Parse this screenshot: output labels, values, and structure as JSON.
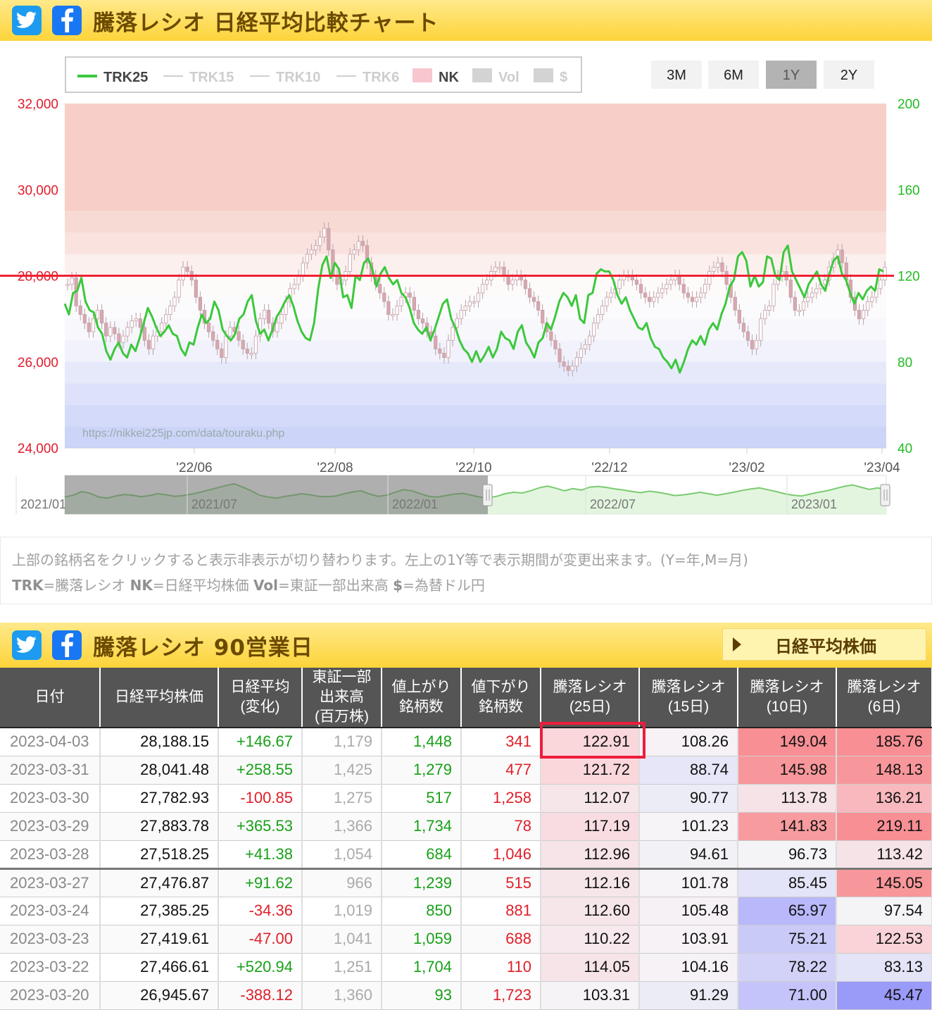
{
  "top_header": {
    "title": "騰落レシオ 日経平均比較チャート",
    "twitter_icon": "twitter-icon",
    "facebook_icon": "facebook-icon"
  },
  "legend": [
    {
      "label": "TRK25",
      "active": true,
      "color": "#3cc83c"
    },
    {
      "label": "TRK15",
      "active": false
    },
    {
      "label": "TRK10",
      "active": false
    },
    {
      "label": "TRK6",
      "active": false
    },
    {
      "label": "NK",
      "active": true,
      "color": "#f7c6cf"
    },
    {
      "label": "Vol",
      "active": false
    },
    {
      "label": "$",
      "active": false
    }
  ],
  "range_buttons": [
    {
      "label": "3M",
      "selected": false
    },
    {
      "label": "6M",
      "selected": false
    },
    {
      "label": "1Y",
      "selected": true
    },
    {
      "label": "2Y",
      "selected": false
    }
  ],
  "chart_data": {
    "type": "line",
    "left_axis_ticks": [
      "32,000",
      "30,000",
      "28,000",
      "26,000",
      "24,000"
    ],
    "right_axis_ticks": [
      "200",
      "160",
      "120",
      "80",
      "40"
    ],
    "x_ticks": [
      "'22/06",
      "'22/08",
      "'22/10",
      "'22/12",
      "'23/02",
      "'23/04"
    ],
    "left_ylim": [
      24000,
      32000
    ],
    "right_ylim": [
      40,
      200
    ],
    "reference_line": {
      "axis": "right",
      "value": 120,
      "color": "#ee2233"
    },
    "series": [
      {
        "name": "TRK25",
        "axis": "right",
        "color": "#3cc83c",
        "values": [
          107,
          102,
          112,
          113,
          119,
          108,
          104,
          103,
          96,
          93,
          85,
          81,
          86,
          89,
          84,
          82,
          88,
          85,
          91,
          98,
          105,
          101,
          96,
          92,
          94,
          97,
          93,
          92,
          86,
          83,
          89,
          88,
          96,
          102,
          98,
          100,
          108,
          104,
          95,
          92,
          90,
          93,
          100,
          102,
          108,
          111,
          99,
          93,
          95,
          90,
          95,
          101,
          104,
          108,
          111,
          106,
          99,
          94,
          91,
          90,
          98,
          114,
          125,
          129,
          119,
          126,
          123,
          110,
          111,
          105,
          120,
          118,
          126,
          128,
          123,
          115,
          121,
          124,
          119,
          116,
          118,
          112,
          110,
          105,
          98,
          95,
          93,
          96,
          90,
          95,
          101,
          107,
          109,
          100,
          96,
          90,
          86,
          84,
          80,
          85,
          80,
          83,
          87,
          82,
          86,
          94,
          91,
          90,
          86,
          94,
          97,
          89,
          86,
          82,
          89,
          91,
          98,
          95,
          101,
          108,
          112,
          110,
          106,
          111,
          100,
          98,
          111,
          112,
          121,
          123,
          122,
          122,
          118,
          111,
          107,
          110,
          104,
          100,
          96,
          95,
          98,
          91,
          87,
          86,
          82,
          80,
          77,
          81,
          75,
          80,
          86,
          90,
          88,
          92,
          88,
          95,
          98,
          95,
          102,
          107,
          115,
          118,
          129,
          131,
          127,
          115,
          120,
          115,
          117,
          129,
          128,
          120,
          118,
          131,
          134,
          122,
          118,
          114,
          110,
          116,
          119,
          122,
          116,
          113,
          121,
          127,
          129,
          121,
          118,
          112,
          107,
          112,
          109,
          113,
          115,
          113,
          123,
          122
        ]
      },
      {
        "name": "NK",
        "axis": "left",
        "type": "candlestick",
        "color": "#d7a8b0",
        "values": [
          27800,
          27950,
          27300,
          27100,
          26900,
          26700,
          27000,
          27200,
          26900,
          26600,
          26800,
          26650,
          26450,
          26600,
          26800,
          26950,
          27000,
          26800,
          26500,
          26300,
          26600,
          26700,
          26900,
          27100,
          27300,
          27500,
          27900,
          28200,
          28100,
          27900,
          27500,
          27200,
          26900,
          26700,
          26500,
          26300,
          26100,
          26600,
          26800,
          26700,
          26500,
          26300,
          26200,
          26200,
          26600,
          27000,
          27200,
          26900,
          26700,
          26900,
          27100,
          27400,
          27700,
          27800,
          28000,
          28300,
          28500,
          28600,
          28700,
          28900,
          29100,
          28600,
          28000,
          27800,
          27900,
          28100,
          28500,
          28600,
          28800,
          28700,
          28300,
          28000,
          27800,
          27600,
          27400,
          27100,
          27100,
          27300,
          27500,
          27600,
          27500,
          27200,
          27000,
          26900,
          26700,
          26600,
          26300,
          26200,
          26100,
          26500,
          26800,
          27000,
          27200,
          27300,
          27400,
          27400,
          27600,
          27800,
          27900,
          28100,
          28200,
          28200,
          28000,
          27800,
          27900,
          28000,
          27900,
          27700,
          27500,
          27400,
          27200,
          26900,
          26700,
          26500,
          26300,
          26000,
          25900,
          25800,
          25900,
          26100,
          26300,
          26400,
          26600,
          26900,
          27100,
          27300,
          27500,
          27600,
          27700,
          27900,
          28000,
          28000,
          27900,
          27800,
          27600,
          27500,
          27400,
          27500,
          27600,
          27700,
          27800,
          27900,
          28000,
          27800,
          27600,
          27500,
          27400,
          27500,
          27600,
          27800,
          28100,
          28200,
          28300,
          28100,
          27800,
          27500,
          27200,
          26900,
          26700,
          26500,
          26300,
          26500,
          27000,
          27200,
          27300,
          27800,
          28000,
          28100,
          27900,
          27500,
          27200,
          27200,
          27400,
          27500,
          27600,
          27700,
          27800,
          27900,
          28200,
          28400,
          28600,
          28300,
          27900,
          27500,
          27200,
          27000,
          27200,
          27400,
          27500,
          27700,
          27900,
          28200
        ]
      }
    ]
  },
  "watermark": "https://nikkei225jp.com/data/touraku.php",
  "navigator": {
    "labels": [
      "2021/01",
      "2021/07",
      "2022/01",
      "2022/07",
      "2023/01"
    ]
  },
  "description": {
    "line1": "上部の銘柄名をクリックすると表示非表示が切り替わります。左上の1Y等で表示期間が変更出来ます。(Y=年,M=月)",
    "line2_parts": [
      {
        "b": "TRK",
        "t": "=騰落レシオ "
      },
      {
        "b": "NK",
        "t": "=日経平均株価 "
      },
      {
        "b": "Vol",
        "t": "=東証一部出来高 "
      },
      {
        "b": "$",
        "t": "=為替ドル円"
      }
    ]
  },
  "table_header": {
    "title": "騰落レシオ 90営業日",
    "nk_button": "日経平均株価"
  },
  "columns": [
    [
      "日付"
    ],
    [
      "日経平均株価"
    ],
    [
      "日経平均",
      "(変化)"
    ],
    [
      "東証一部",
      "出来高",
      "(百万株)"
    ],
    [
      "値上がり",
      "銘柄数"
    ],
    [
      "値下がり",
      "銘柄数"
    ],
    [
      "騰落レシオ",
      "(25日)"
    ],
    [
      "騰落レシオ",
      "(15日)"
    ],
    [
      "騰落レシオ",
      "(10日)"
    ],
    [
      "騰落レシオ",
      "(6日)"
    ]
  ],
  "rows": [
    {
      "date": "2023-04-03",
      "nk": "28,188.15",
      "chg": "+146.67",
      "vol": "1,179",
      "up": "1,448",
      "down": "341",
      "r25": "122.91",
      "r15": "108.26",
      "r10": "149.04",
      "r6": "185.76",
      "c25": "#fad7db",
      "c15": "#f7f2f5",
      "c10": "#f88f94",
      "c6": "#f88f94"
    },
    {
      "date": "2023-03-31",
      "nk": "28,041.48",
      "chg": "+258.55",
      "vol": "1,425",
      "up": "1,279",
      "down": "477",
      "r25": "121.72",
      "r15": "88.74",
      "r10": "145.98",
      "r6": "148.13",
      "c25": "#fad7db",
      "c15": "#e6e6f8",
      "c10": "#f8979b",
      "c6": "#f8979b"
    },
    {
      "date": "2023-03-30",
      "nk": "27,782.93",
      "chg": "-100.85",
      "vol": "1,275",
      "up": "517",
      "down": "1,258",
      "r25": "112.07",
      "r15": "90.77",
      "r10": "113.78",
      "r6": "136.21",
      "c25": "#f6e6ea",
      "c15": "#ececf7",
      "c10": "#f5e3e7",
      "c6": "#f9b8bd"
    },
    {
      "date": "2023-03-29",
      "nk": "27,883.78",
      "chg": "+365.53",
      "vol": "1,366",
      "up": "1,734",
      "down": "78",
      "r25": "117.19",
      "r15": "101.23",
      "r10": "141.83",
      "r6": "219.11",
      "c25": "#f8dce1",
      "c15": "#f6f4f6",
      "c10": "#f89b9f",
      "c6": "#f88f94"
    },
    {
      "date": "2023-03-28",
      "nk": "27,518.25",
      "chg": "+41.38",
      "vol": "1,054",
      "up": "684",
      "down": "1,046",
      "r25": "112.96",
      "r15": "94.61",
      "r10": "96.73",
      "r6": "113.42",
      "c25": "#f6e4e8",
      "c15": "#f2f2f6",
      "c10": "#f4f3f6",
      "c6": "#f5e3e7"
    },
    {
      "date": "2023-03-27",
      "nk": "27,476.87",
      "chg": "+91.62",
      "vol": "966",
      "up": "1,239",
      "down": "515",
      "r25": "112.16",
      "r15": "101.78",
      "r10": "85.45",
      "r6": "145.05",
      "c25": "#f6e6ea",
      "c15": "#f6f4f6",
      "c10": "#e4e4f8",
      "c6": "#f8979b"
    },
    {
      "date": "2023-03-24",
      "nk": "27,385.25",
      "chg": "-34.36",
      "vol": "1,019",
      "up": "850",
      "down": "881",
      "r25": "112.60",
      "r15": "105.48",
      "r10": "65.97",
      "r6": "97.54",
      "c25": "#f6e6ea",
      "c15": "#f6f1f4",
      "c10": "#b8b8fa",
      "c6": "#f4f3f6"
    },
    {
      "date": "2023-03-23",
      "nk": "27,419.61",
      "chg": "-47.00",
      "vol": "1,041",
      "up": "1,059",
      "down": "688",
      "r25": "110.22",
      "r15": "103.91",
      "r10": "75.21",
      "r6": "122.53",
      "c25": "#f6e8ec",
      "c15": "#f6f2f5",
      "c10": "#cacaf8",
      "c6": "#f9d3d7"
    },
    {
      "date": "2023-03-22",
      "nk": "27,466.61",
      "chg": "+520.94",
      "vol": "1,251",
      "up": "1,704",
      "down": "110",
      "r25": "114.05",
      "r15": "104.16",
      "r10": "78.22",
      "r6": "83.13",
      "c25": "#f6e4e8",
      "c15": "#f6f2f5",
      "c10": "#d2d2f8",
      "c6": "#e4e4f8"
    },
    {
      "date": "2023-03-20",
      "nk": "26,945.67",
      "chg": "-388.12",
      "vol": "1,360",
      "up": "93",
      "down": "1,723",
      "r25": "103.31",
      "r15": "91.29",
      "r10": "71.00",
      "r6": "45.47",
      "c25": "#f5f3f6",
      "c15": "#ececf7",
      "c10": "#c4c4fa",
      "c6": "#9a9af8"
    }
  ]
}
